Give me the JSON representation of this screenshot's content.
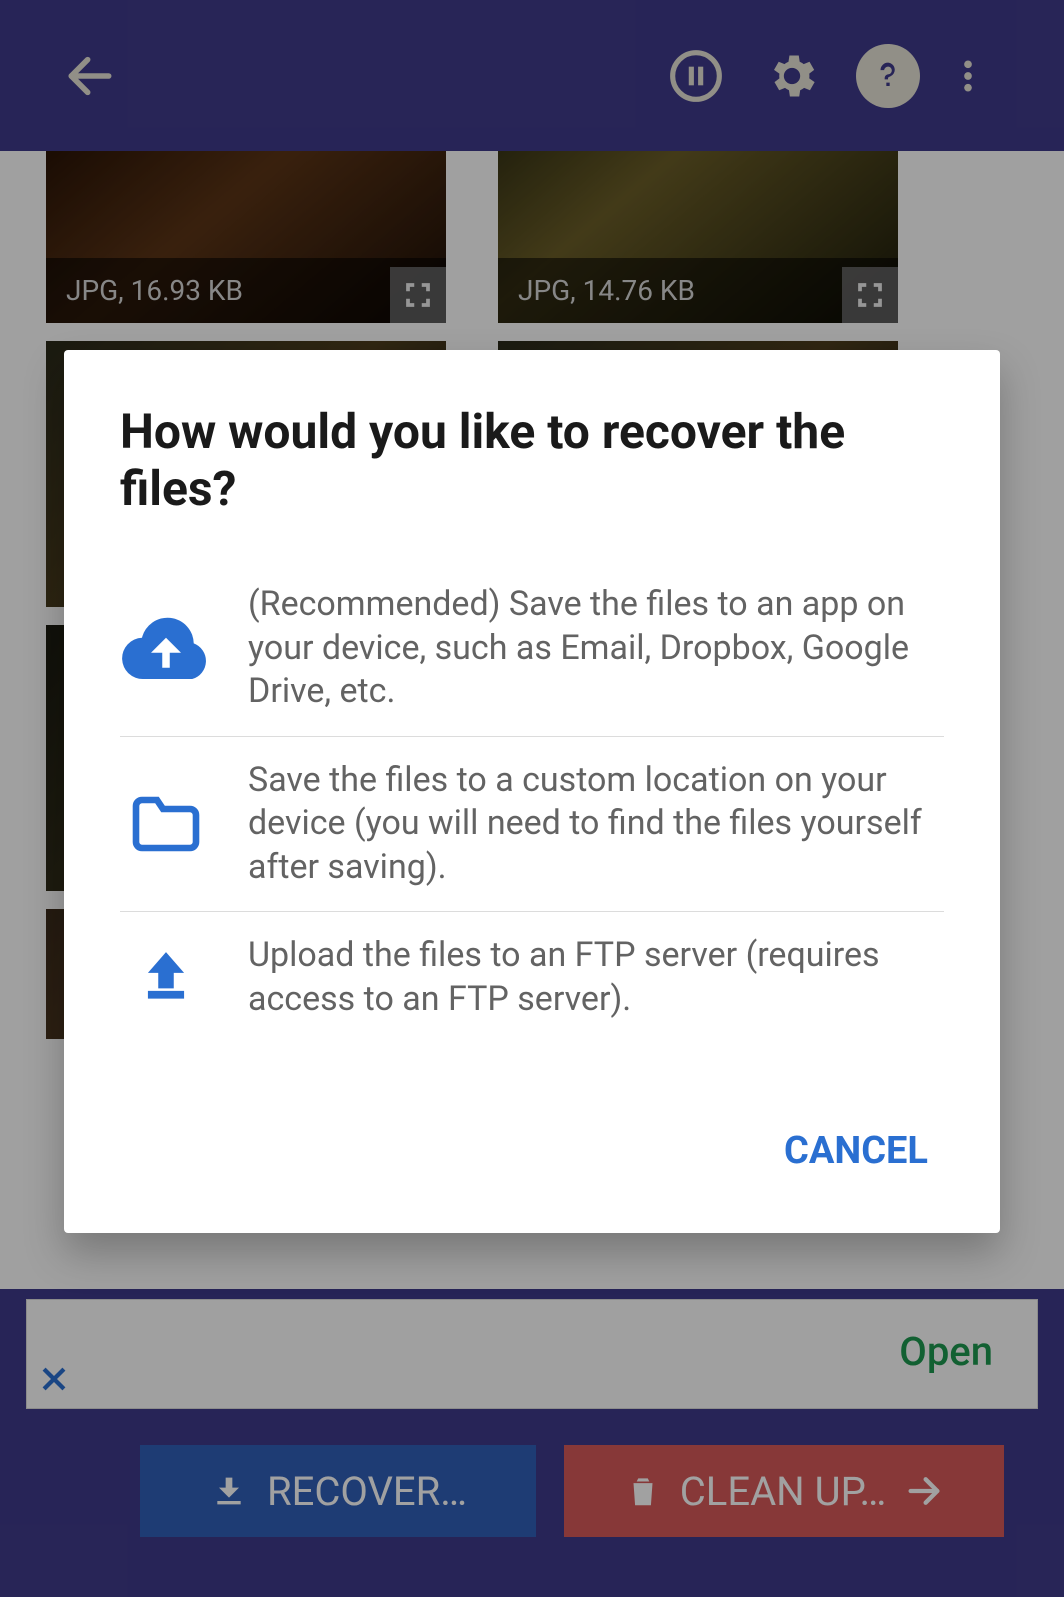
{
  "dialog": {
    "title": "How would you like to recover the files?",
    "options": [
      {
        "text": "(Recommended) Save the files to an app on your device, such as Email, Dropbox, Google Drive, etc."
      },
      {
        "text": "Save the files to a custom location on your device (you will need to find the files yourself after saving)."
      },
      {
        "text": "Upload the files to an FTP server (requires access to an FTP server)."
      }
    ],
    "cancel_label": "CANCEL"
  },
  "grid": {
    "items": [
      {
        "label": "JPG, 16.93 KB"
      },
      {
        "label": "JPG, 14.76 KB"
      }
    ]
  },
  "bottom": {
    "recover_label": "RECOVER…",
    "cleanup_label": "CLEAN UP…"
  },
  "ad": {
    "open_label": "Open"
  }
}
